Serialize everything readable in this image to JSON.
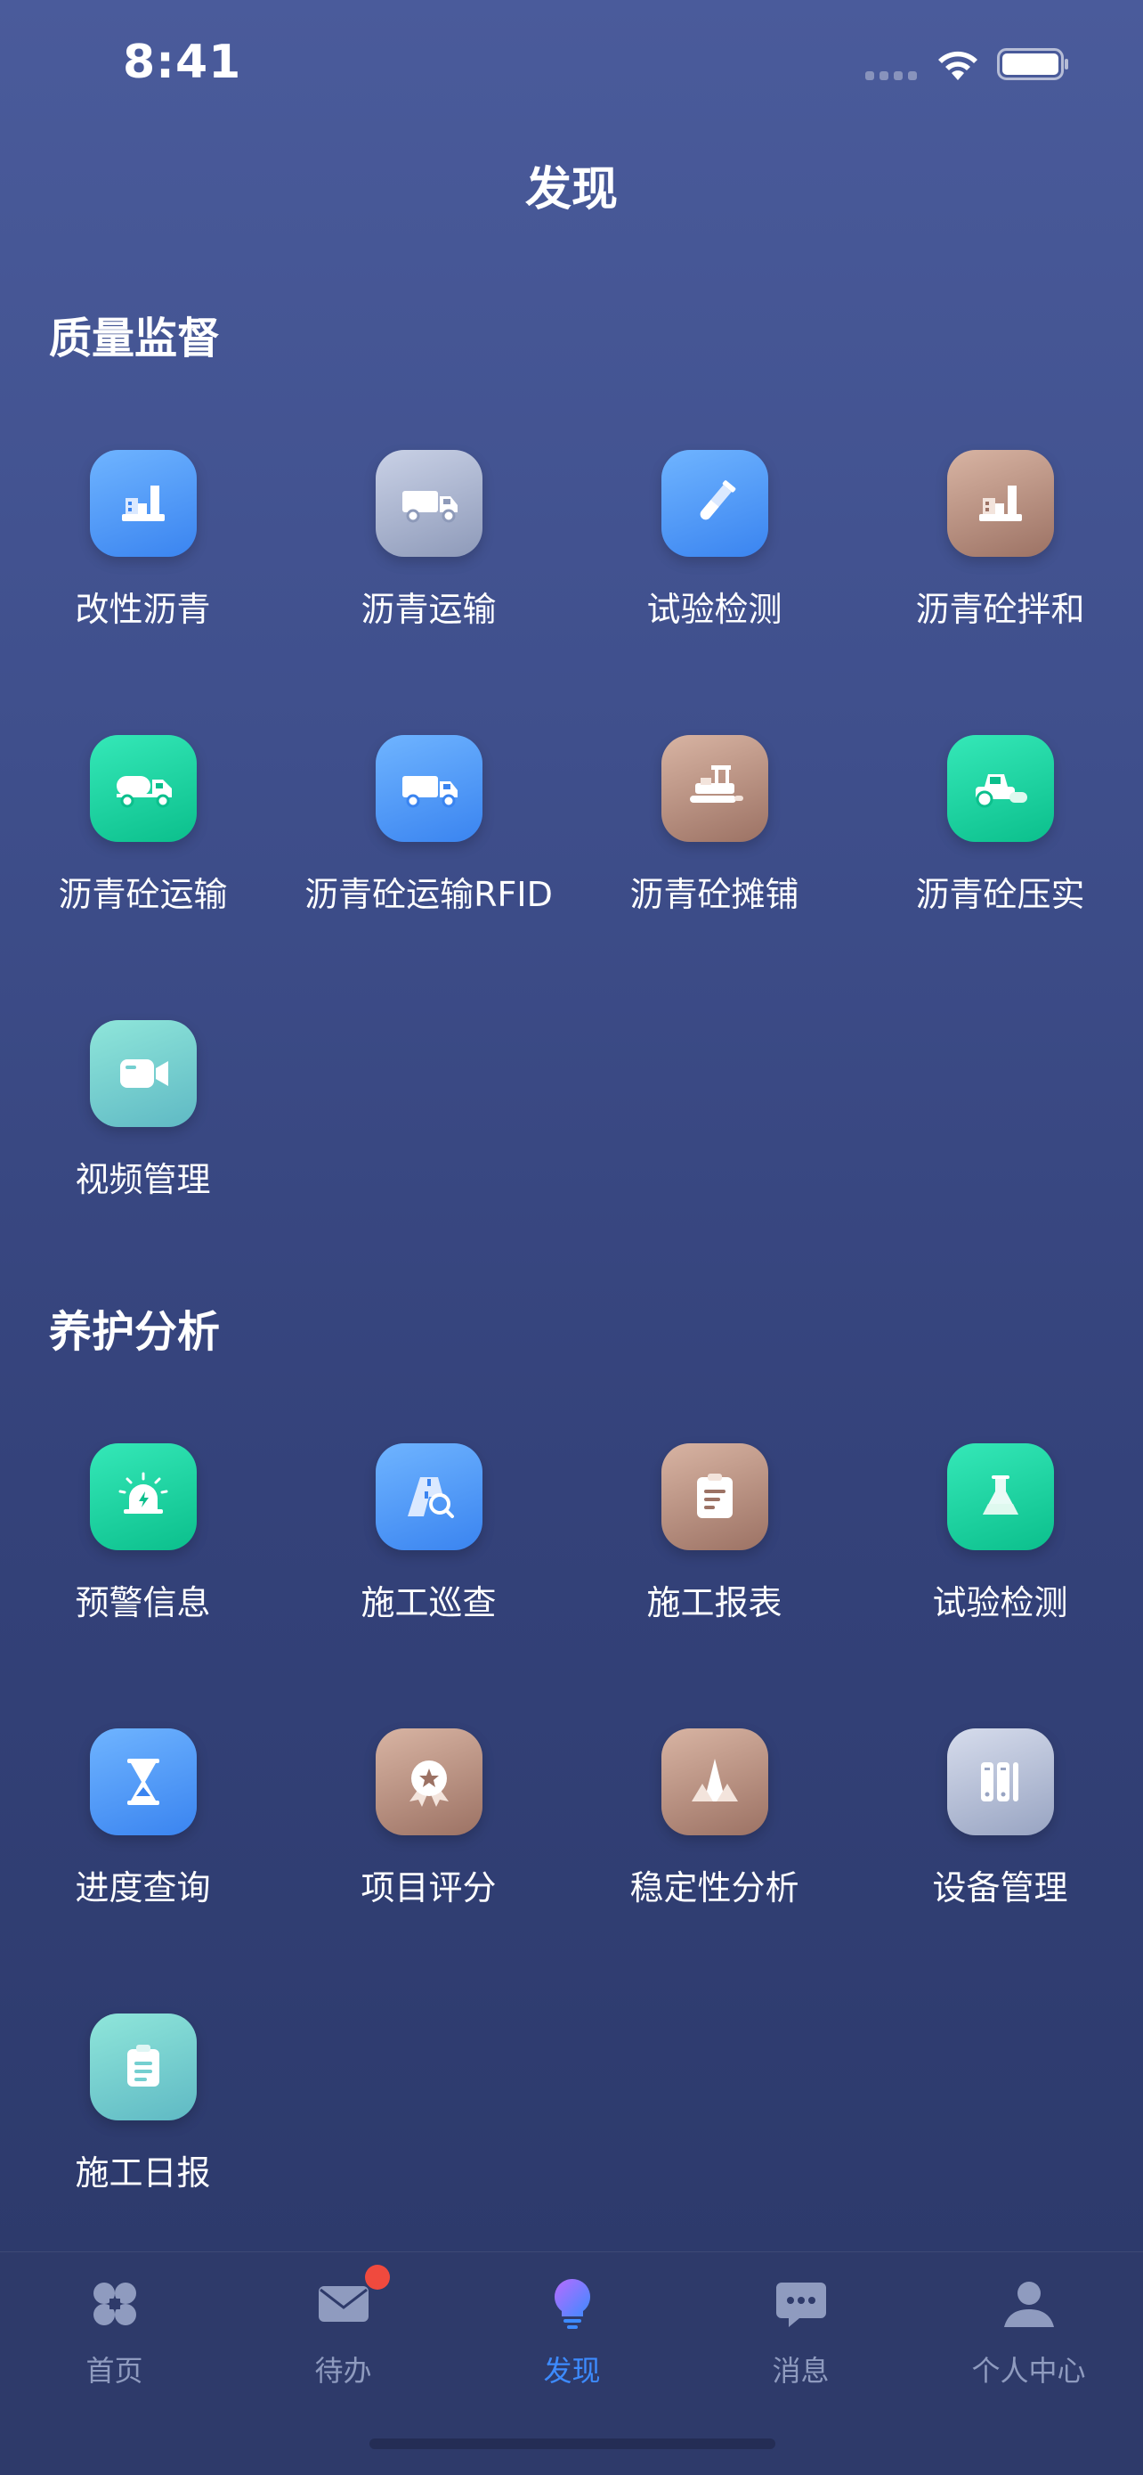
{
  "status_bar": {
    "time": "8:41"
  },
  "page": {
    "title": "发现"
  },
  "sections": [
    {
      "title": "质量监督",
      "items": [
        {
          "label": "改性沥青",
          "icon": "factory-icon",
          "color": "#4c97f6"
        },
        {
          "label": "沥青运输",
          "icon": "truck-icon",
          "color": "#a6b0cc"
        },
        {
          "label": "试验检测",
          "icon": "test-tube-icon",
          "color": "#4c97f6"
        },
        {
          "label": "沥青砼拌和",
          "icon": "factory-icon",
          "color": "#b88c7c"
        },
        {
          "label": "沥青砼运输",
          "icon": "tanker-truck-icon",
          "color": "#13cc98"
        },
        {
          "label": "沥青砼运输RFID",
          "icon": "truck-icon",
          "color": "#4c97f6"
        },
        {
          "label": "沥青砼摊铺",
          "icon": "paver-icon",
          "color": "#b88c7c"
        },
        {
          "label": "沥青砼压实",
          "icon": "road-roller-icon",
          "color": "#13cc98"
        },
        {
          "label": "视频管理",
          "icon": "video-camera-icon",
          "color": "#74cfd0"
        }
      ]
    },
    {
      "title": "养护分析",
      "items": [
        {
          "label": "预警信息",
          "icon": "alarm-icon",
          "color": "#13cc98"
        },
        {
          "label": "施工巡查",
          "icon": "road-search-icon",
          "color": "#4c97f6"
        },
        {
          "label": "施工报表",
          "icon": "report-icon",
          "color": "#b88c7c"
        },
        {
          "label": "试验检测",
          "icon": "flask-icon",
          "color": "#13cc98"
        },
        {
          "label": "进度查询",
          "icon": "hourglass-icon",
          "color": "#4c97f6"
        },
        {
          "label": "项目评分",
          "icon": "award-icon",
          "color": "#b88c7c"
        },
        {
          "label": "稳定性分析",
          "icon": "mountain-icon",
          "color": "#b88c7c"
        },
        {
          "label": "设备管理",
          "icon": "devices-icon",
          "color": "#b3bdd6"
        },
        {
          "label": "施工日报",
          "icon": "clipboard-icon",
          "color": "#74cfd0"
        }
      ]
    }
  ],
  "tab_bar": {
    "tabs": [
      {
        "label": "首页",
        "icon": "grid-icon",
        "active": false
      },
      {
        "label": "待办",
        "icon": "mail-icon",
        "active": false,
        "badge": true
      },
      {
        "label": "发现",
        "icon": "bulb-icon",
        "active": true
      },
      {
        "label": "消息",
        "icon": "chat-icon",
        "active": false
      },
      {
        "label": "个人中心",
        "icon": "person-icon",
        "active": false
      }
    ],
    "active_color": "#3d8bff",
    "inactive_color": "#8f9bbf"
  }
}
